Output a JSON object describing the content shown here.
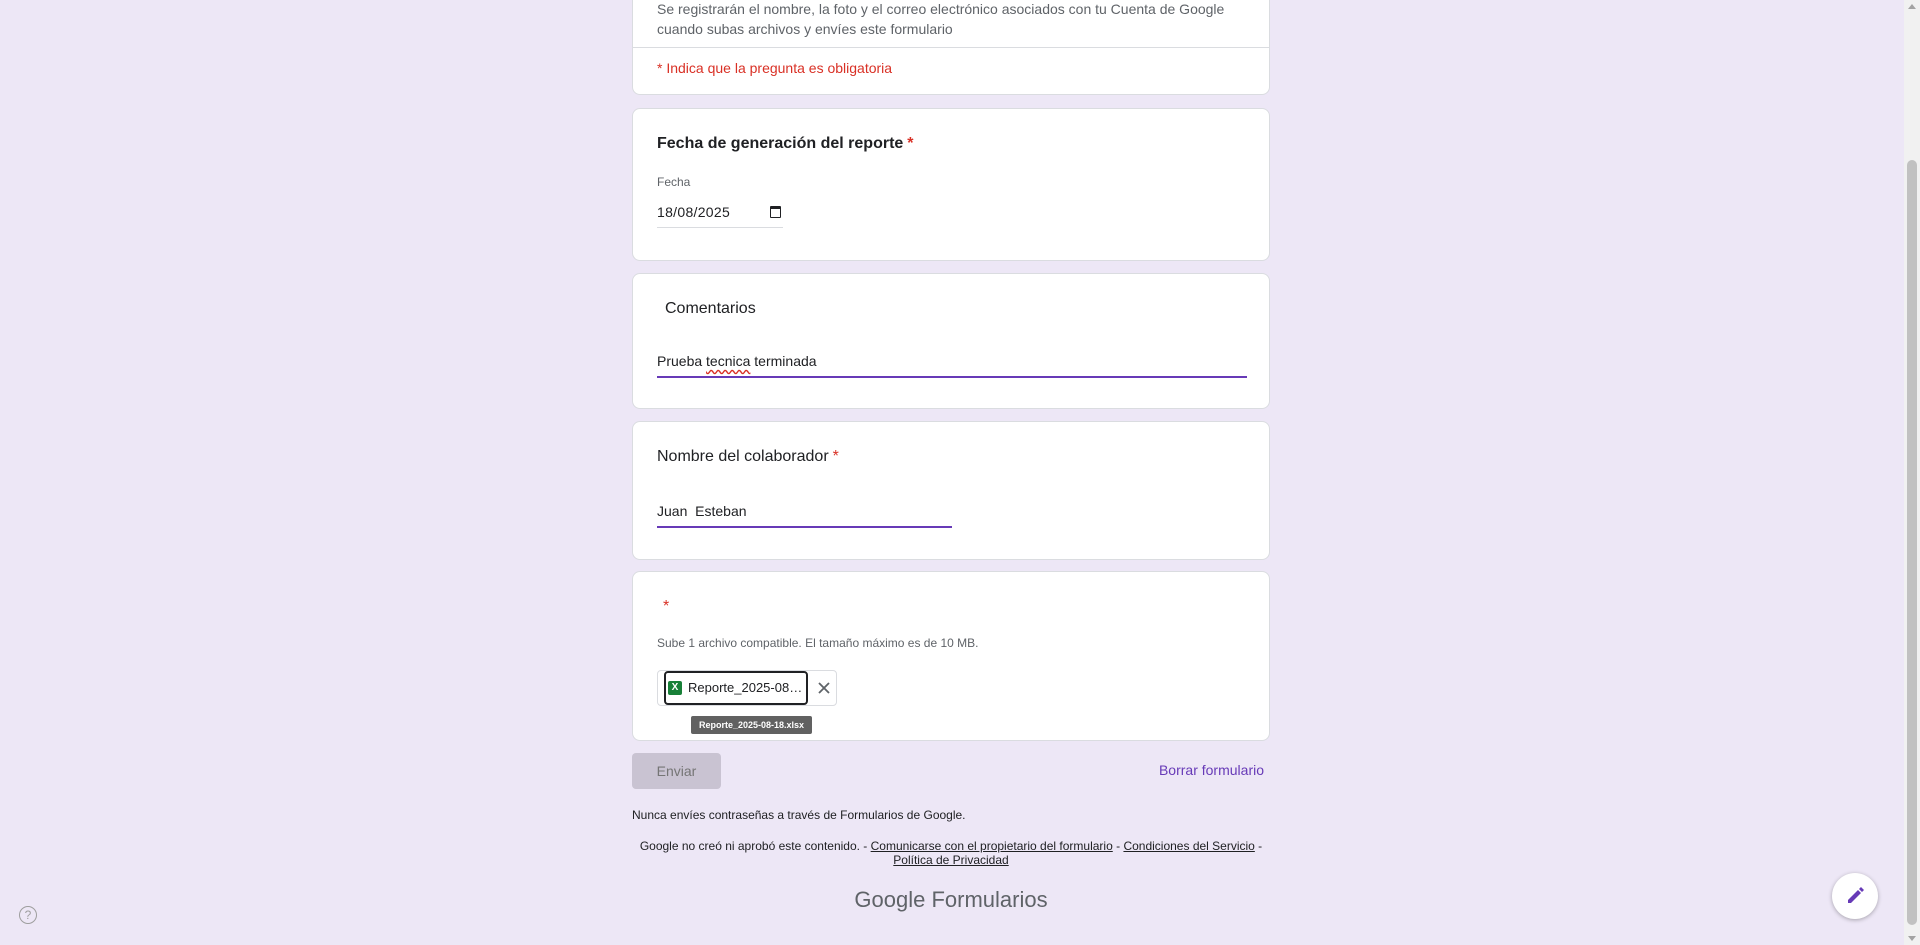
{
  "header": {
    "notice": "Se registrarán el nombre, la foto y el correo electrónico asociados con tu Cuenta de Google cuando subas archivos y envíes este formulario",
    "required_note": "* Indica que la pregunta es obligatoria"
  },
  "questions": {
    "date": {
      "title": "Fecha de generación del reporte",
      "asterisk": "*",
      "label": "Fecha",
      "value": "18/08/2025"
    },
    "comments": {
      "title": "Comentarios",
      "value_prefix": "Prueba ",
      "value_misspelled": "tecnica",
      "value_suffix": " terminada"
    },
    "collaborator": {
      "title": "Nombre del colaborador",
      "asterisk": "*",
      "value": "Juan  Esteban"
    },
    "upload": {
      "asterisk": "*",
      "hint": "Sube 1 archivo compatible. El tamaño máximo es de 10 MB.",
      "file_name_truncated": "Reporte_2025-08…",
      "file_icon_letter": "X",
      "tooltip": "Reporte_2025-08-18.xlsx"
    }
  },
  "actions": {
    "submit_label": "Enviar",
    "clear_label": "Borrar formulario"
  },
  "footer": {
    "warning": "Nunca envíes contraseñas a través de Formularios de Google.",
    "legal_prefix": "Google no creó ni aprobó este contenido. - ",
    "link_contact": "Comunicarse con el propietario del formulario",
    "sep1": " - ",
    "link_terms": "Condiciones del Servicio",
    "sep2": " - ",
    "link_privacy": "Política de Privacidad",
    "brand_google": "Google",
    "brand_product": "Formularios"
  },
  "icons": {
    "help": "help-circle-icon",
    "edit": "pencil-icon",
    "remove": "close-icon",
    "file": "excel-file-icon",
    "calendar": "calendar-icon"
  },
  "colors": {
    "accent": "#673ab7",
    "required": "#d93025",
    "background": "#ede7f6",
    "excel": "#188038"
  }
}
